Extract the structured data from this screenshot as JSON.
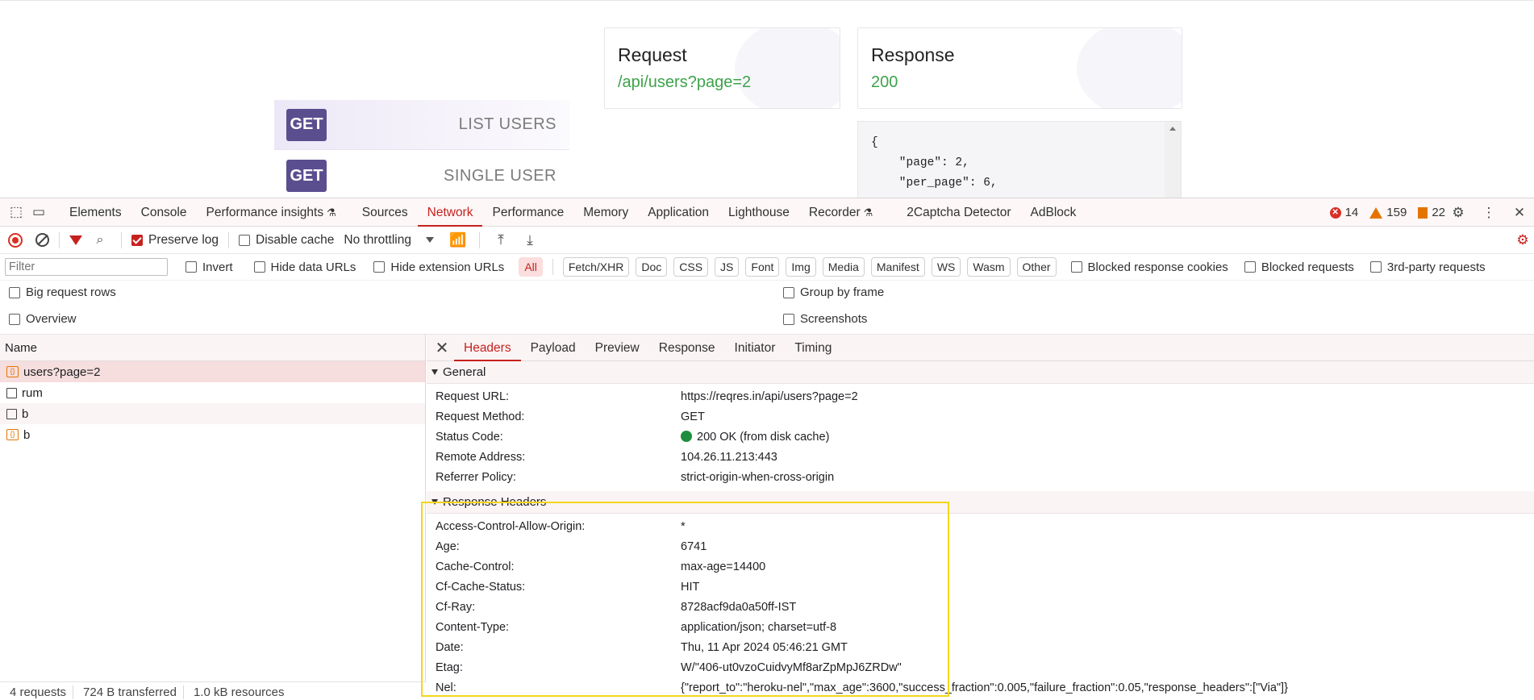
{
  "webpage": {
    "endpoints": [
      {
        "method": "GET",
        "name": "LIST USERS"
      },
      {
        "method": "GET",
        "name": "SINGLE USER"
      }
    ],
    "request_card": {
      "title": "Request",
      "value": "/api/users?page=2"
    },
    "response_card": {
      "title": "Response",
      "value": "200"
    },
    "code_lines": [
      "{",
      "    \"page\": 2,",
      "    \"per_page\": 6,"
    ]
  },
  "devtools": {
    "main_tabs": [
      "Elements",
      "Console",
      "Performance insights",
      "Sources",
      "Network",
      "Performance",
      "Memory",
      "Application",
      "Lighthouse",
      "Recorder",
      "2Captcha Detector",
      "AdBlock"
    ],
    "active_tab": "Network",
    "counters": {
      "errors": "14",
      "warnings": "159",
      "issues": "22"
    },
    "toolbar": {
      "preserve_log": "Preserve log",
      "disable_cache": "Disable cache",
      "throttling": "No throttling"
    },
    "filter": {
      "placeholder": "Filter",
      "invert": "Invert",
      "hide_data_urls": "Hide data URLs",
      "hide_extension_urls": "Hide extension URLs",
      "types": [
        "All",
        "Fetch/XHR",
        "Doc",
        "CSS",
        "JS",
        "Font",
        "Img",
        "Media",
        "Manifest",
        "WS",
        "Wasm",
        "Other"
      ],
      "blocked_response_cookies": "Blocked response cookies",
      "blocked_requests": "Blocked requests",
      "third_party": "3rd-party requests"
    },
    "options": {
      "big_request_rows": "Big request rows",
      "group_by_frame": "Group by frame",
      "overview": "Overview",
      "screenshots": "Screenshots"
    },
    "request_list": {
      "header": "Name",
      "rows": [
        "users?page=2",
        "rum",
        "b",
        "b"
      ],
      "status": {
        "requests": "4 requests",
        "transferred": "724 B transferred",
        "resources": "1.0 kB resources"
      }
    },
    "details": {
      "tabs": [
        "Headers",
        "Payload",
        "Preview",
        "Response",
        "Initiator",
        "Timing"
      ],
      "active_tab": "Headers",
      "general_title": "General",
      "general": [
        {
          "k": "Request URL:",
          "v": "https://reqres.in/api/users?page=2"
        },
        {
          "k": "Request Method:",
          "v": "GET"
        },
        {
          "k": "Status Code:",
          "v": "200 OK (from disk cache)"
        },
        {
          "k": "Remote Address:",
          "v": "104.26.11.213:443"
        },
        {
          "k": "Referrer Policy:",
          "v": "strict-origin-when-cross-origin"
        }
      ],
      "response_headers_title": "Response Headers",
      "response_headers": [
        {
          "k": "Access-Control-Allow-Origin:",
          "v": "*"
        },
        {
          "k": "Age:",
          "v": "6741"
        },
        {
          "k": "Cache-Control:",
          "v": "max-age=14400"
        },
        {
          "k": "Cf-Cache-Status:",
          "v": "HIT"
        },
        {
          "k": "Cf-Ray:",
          "v": "8728acf9da0a50ff-IST"
        },
        {
          "k": "Content-Type:",
          "v": "application/json; charset=utf-8"
        },
        {
          "k": "Date:",
          "v": "Thu, 11 Apr 2024 05:46:21 GMT"
        },
        {
          "k": "Etag:",
          "v": "W/\"406-ut0vzoCuidvyMf8arZpMpJ6ZRDw\""
        },
        {
          "k": "Nel:",
          "v": "{\"report_to\":\"heroku-nel\",\"max_age\":3600,\"success_fraction\":0.005,\"failure_fraction\":0.05,\"response_headers\":[\"Via\"]}"
        }
      ]
    }
  },
  "colors": {
    "accent": "#c5221f",
    "badge": "#5b4e8f",
    "success": "#3da34a",
    "highlight": "#f2d61c"
  }
}
